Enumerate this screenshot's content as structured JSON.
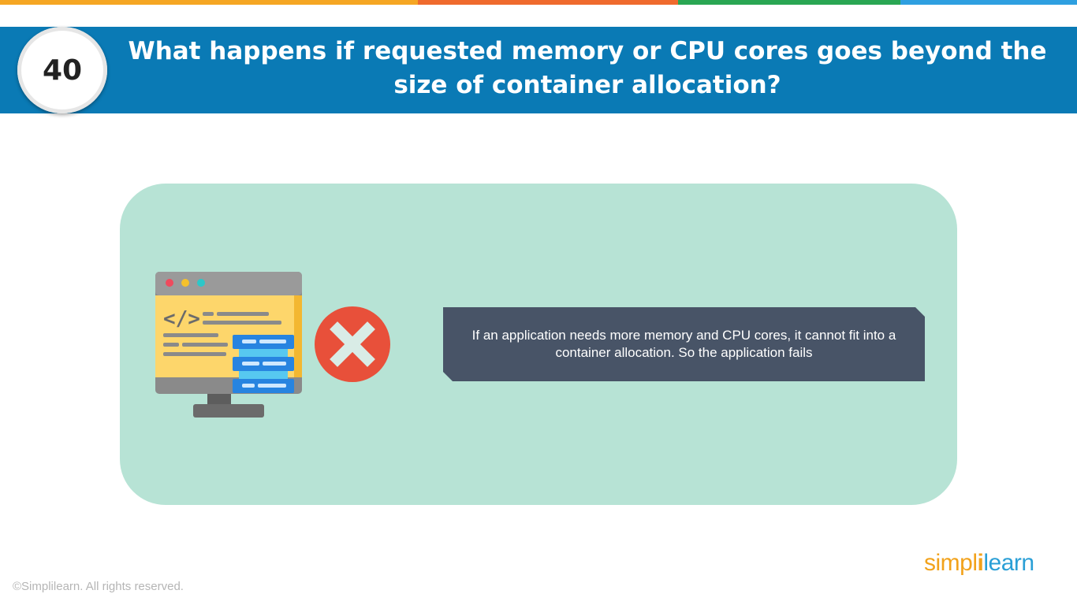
{
  "slide": {
    "number": "40",
    "title": "What happens if requested memory or CPU cores goes beyond the size of container allocation?",
    "answer": "If an application needs more memory and CPU cores, it cannot fit into a container allocation. So the application fails"
  },
  "icons": {
    "illustration": "code-monitor-icon",
    "status": "red-x-icon"
  },
  "branding": {
    "logo_part1": "simpl",
    "logo_divider": "i",
    "logo_part2": "learn",
    "copyright": "©Simplilearn. All rights reserved."
  },
  "colors": {
    "header": "#0a7ab5",
    "card": "#b7e3d5",
    "banner": "#485467",
    "error_red": "#e8503a",
    "strip": [
      "#f5a623",
      "#ef6a2d",
      "#2aa653",
      "#2e9fe0"
    ]
  }
}
